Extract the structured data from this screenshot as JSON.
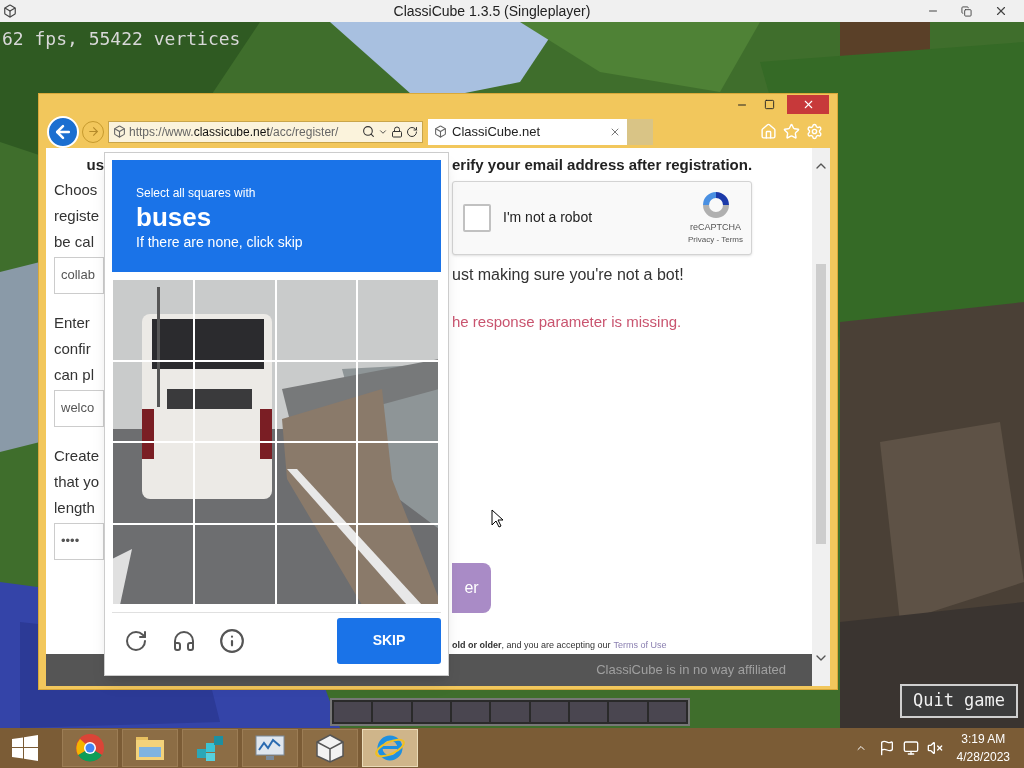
{
  "game_window": {
    "title": "ClassiCube 1.3.5 (Singleplayer)",
    "fps_text": "62 fps, 55422 vertices",
    "quit_button": "Quit game"
  },
  "browser": {
    "address": {
      "prefix": "https://www.",
      "domain": "classicube.net",
      "path": "/acc/register/"
    },
    "tab": {
      "label": "ClassiCube.net",
      "selected": true
    }
  },
  "page": {
    "heading_left": "us",
    "heading_right": "erify your email address after registration.",
    "form_rows": [
      {
        "label_lines": [
          "Choos",
          "registe",
          "be cal"
        ],
        "value": "collab"
      },
      {
        "label_lines": [
          "Enter",
          "confir",
          "can pl"
        ],
        "value": "welco"
      },
      {
        "label_lines": [
          "Create",
          "that yo",
          "length"
        ],
        "value": "••••"
      }
    ],
    "recaptcha": {
      "checked": false,
      "label": "I'm not a robot",
      "brand": "reCAPTCHA",
      "links": "Privacy - Terms"
    },
    "note": "ust making sure you're not a bot!",
    "error": "he response parameter is missing.",
    "submit_button": "er",
    "legal": "**old or older**, and you are accepting our",
    "legal_link": "Terms of Use",
    "footer_text": "ClassiCube is in no way affiliated"
  },
  "challenge": {
    "prompt": "Select all squares with",
    "target": "buses",
    "hint": "If there are none, click skip",
    "tiles": [
      {
        "selected": false
      },
      {
        "selected": false
      },
      {
        "selected": false
      },
      {
        "selected": false
      },
      {
        "selected": false
      },
      {
        "selected": false
      },
      {
        "selected": false
      },
      {
        "selected": false
      },
      {
        "selected": false
      },
      {
        "selected": false
      },
      {
        "selected": false
      },
      {
        "selected": false
      },
      {
        "selected": false
      },
      {
        "selected": false
      },
      {
        "selected": false
      },
      {
        "selected": false
      }
    ],
    "skip_button": "SKIP"
  },
  "taskbar": {
    "apps": [
      {
        "kind": "chrome",
        "selected": false
      },
      {
        "kind": "folder",
        "selected": false
      },
      {
        "kind": "cubes",
        "selected": false
      },
      {
        "kind": "monitor",
        "selected": false
      },
      {
        "kind": "cube",
        "selected": false
      },
      {
        "kind": "ie",
        "selected": true
      }
    ],
    "time": "3:19 AM",
    "date": "4/28/2023"
  }
}
